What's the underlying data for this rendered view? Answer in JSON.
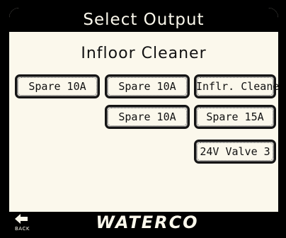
{
  "header": {
    "title": "Select Output"
  },
  "subtitle": "Infloor Cleaner",
  "outputs": [
    {
      "label": "Spare 10A"
    },
    {
      "label": "Spare 10A"
    },
    {
      "label": "Inflr. Cleaner"
    },
    {
      "label": "Spare 10A"
    },
    {
      "label": "Spare 15A"
    },
    {
      "label": "24V Valve 3"
    }
  ],
  "footer": {
    "back_label": "BACK",
    "back_icon": "back-arrow-icon",
    "logo": "WATERCO"
  },
  "colors": {
    "background": "#fbf8ec",
    "bars": "#000000"
  }
}
